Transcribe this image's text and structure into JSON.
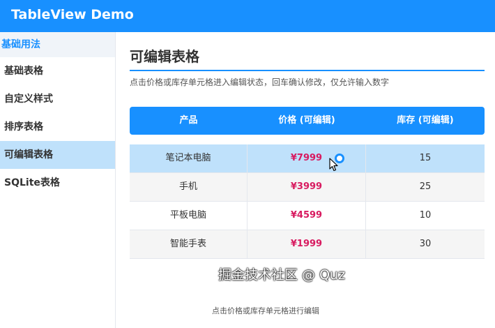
{
  "app": {
    "title": "TableView Demo"
  },
  "colors": {
    "primary": "#1890ff",
    "price": "#d81b60",
    "active_item": "#bfe1fb"
  },
  "sidebar": {
    "section": "基础用法",
    "items": [
      {
        "label": "基础表格"
      },
      {
        "label": "自定义样式"
      },
      {
        "label": "排序表格"
      },
      {
        "label": "可编辑表格",
        "active": true
      },
      {
        "label": "SQLite表格"
      }
    ]
  },
  "main": {
    "title": "可编辑表格",
    "subtitle": "点击价格或库存单元格进入编辑状态，回车确认修改，仅允许输入数字",
    "table": {
      "headers": [
        "产品",
        "价格 (可编辑)",
        "库存 (可编辑)"
      ],
      "rows": [
        {
          "product": "笔记本电脑",
          "price": "¥7999",
          "stock": "15"
        },
        {
          "product": "手机",
          "price": "¥3999",
          "stock": "25"
        },
        {
          "product": "平板电脑",
          "price": "¥4599",
          "stock": "10"
        },
        {
          "product": "智能手表",
          "price": "¥1999",
          "stock": "30"
        }
      ]
    },
    "footer_status": "点击价格或库存单元格进行编辑"
  },
  "icons": {
    "cursor": "arrow-cursor-icon",
    "busy": "busy-ring-icon"
  },
  "watermark": "掘金技术社区 @ Quz"
}
